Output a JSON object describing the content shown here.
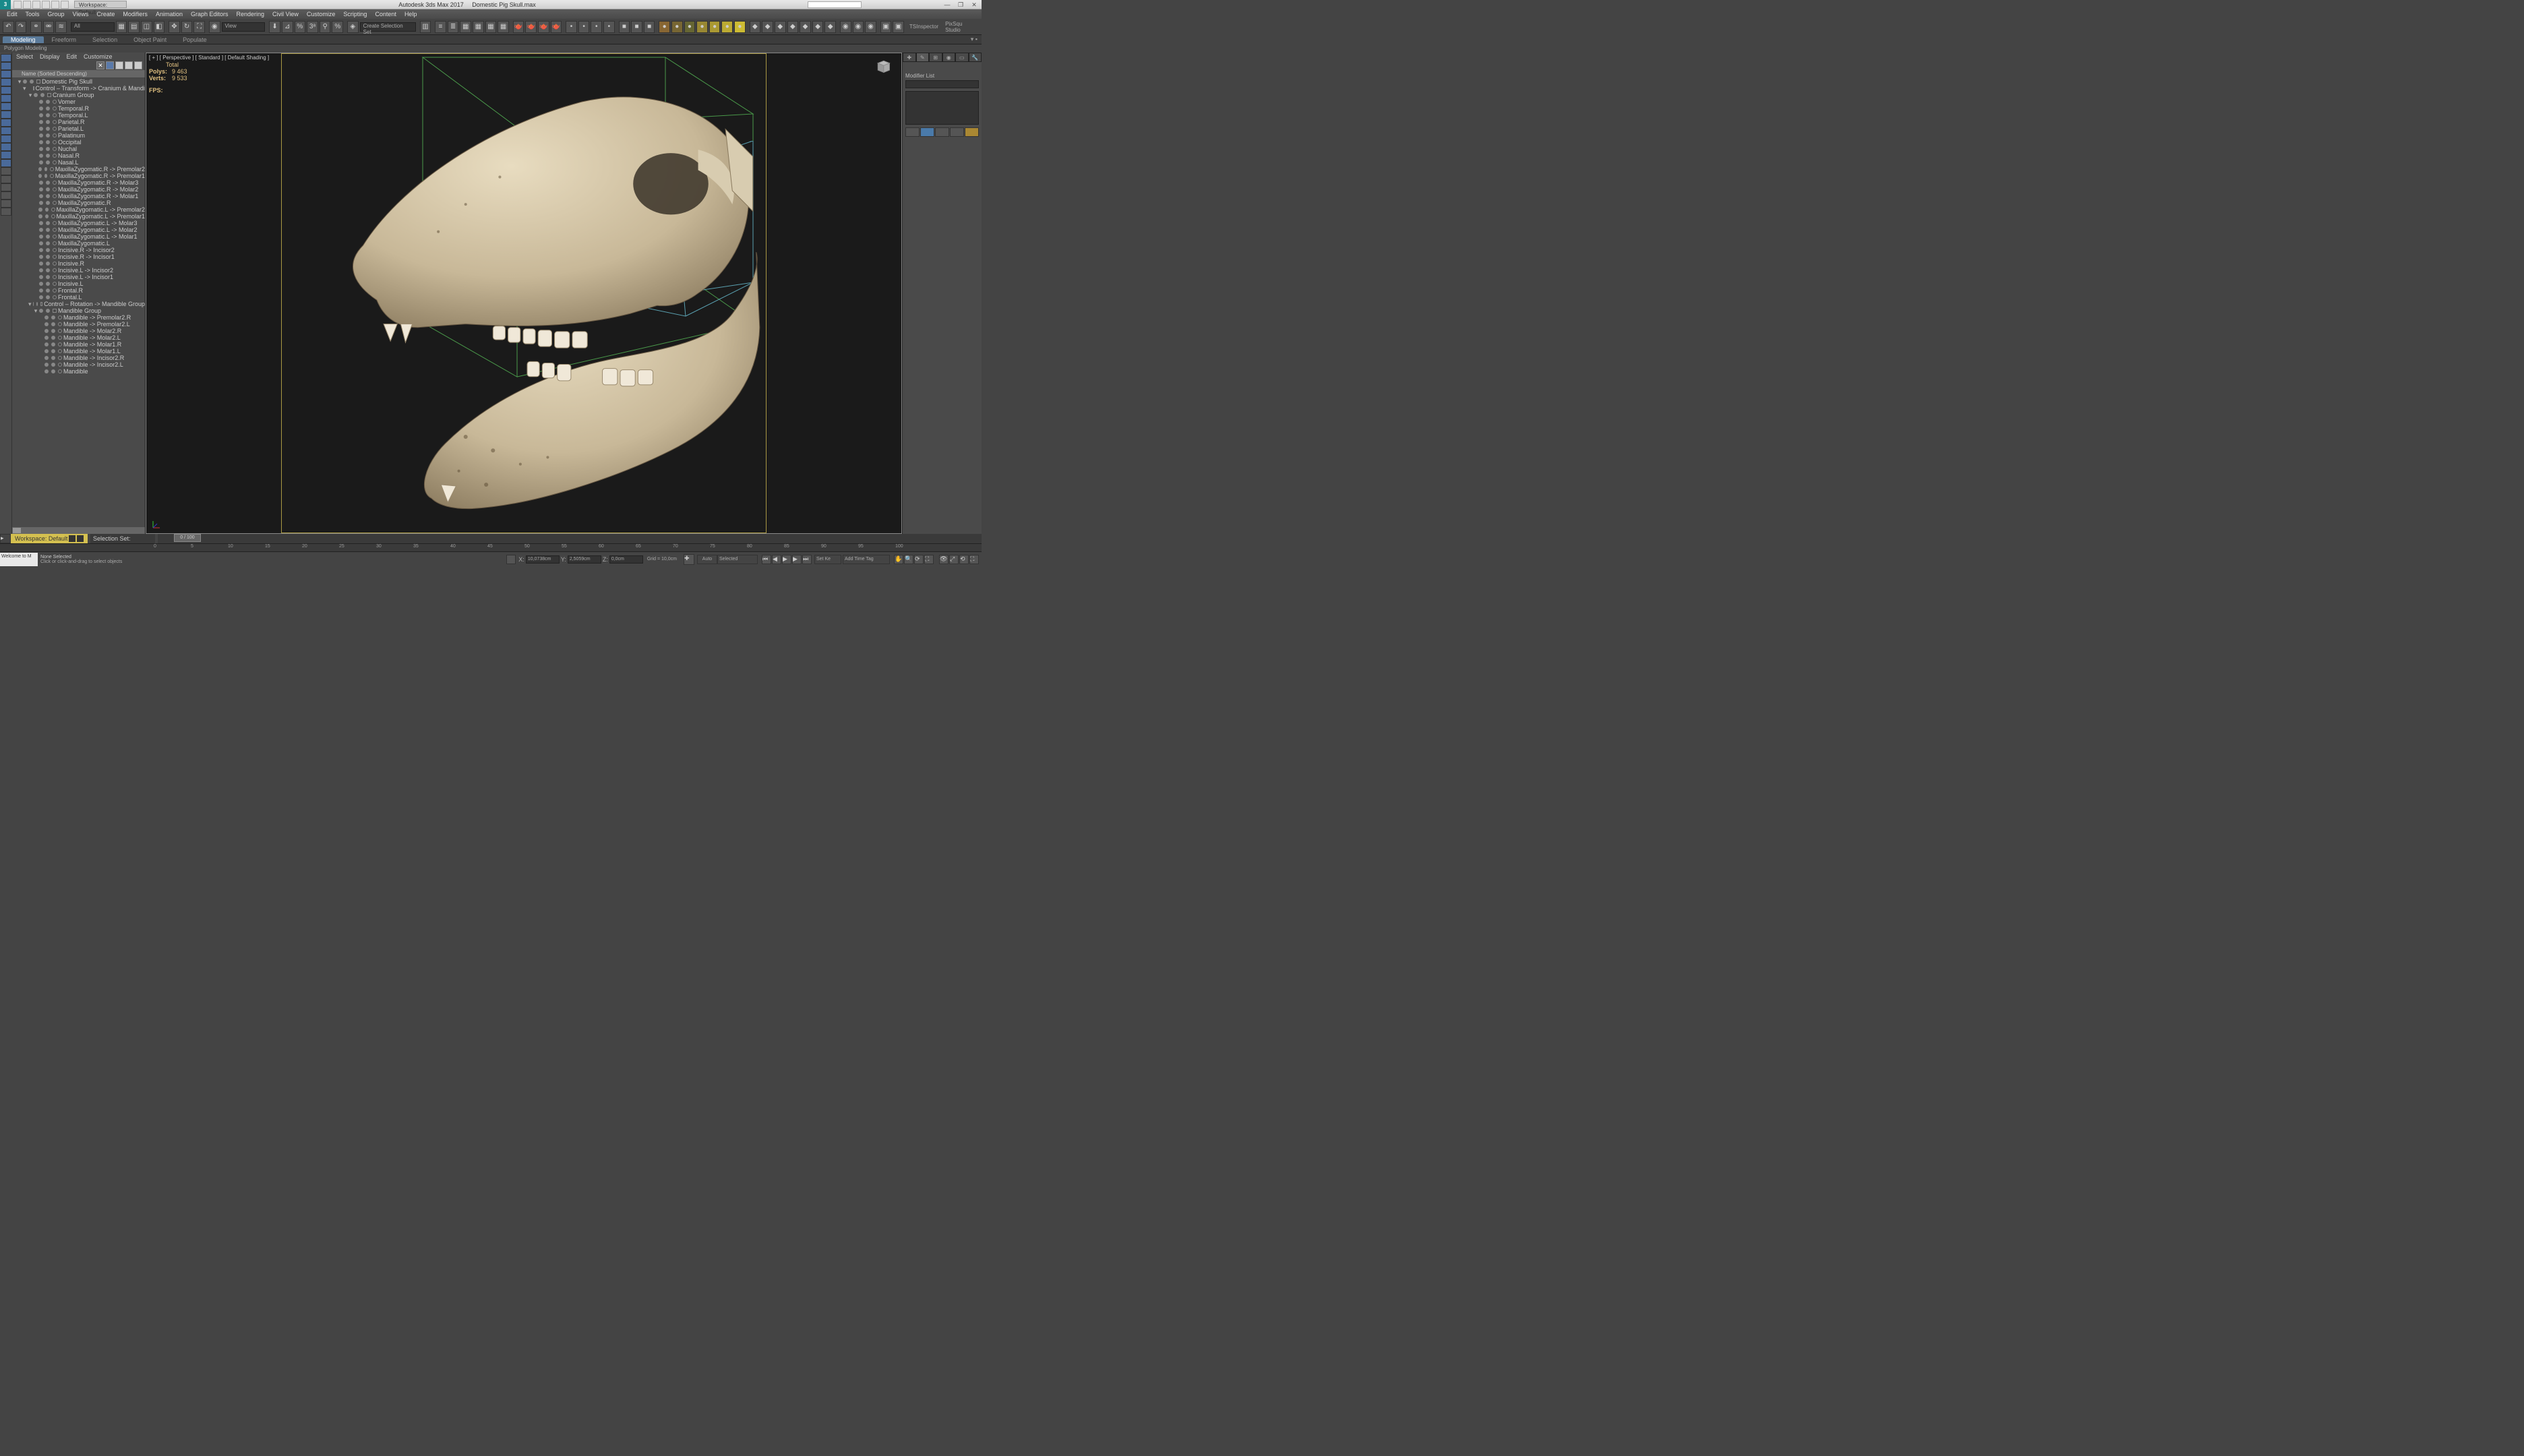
{
  "app": {
    "title": "Autodesk 3ds Max 2017",
    "file": "Domestic Pig Skull.max",
    "workspace": "Workspace: Default",
    "right_labels": [
      "TSInspector",
      "PixSqu Studio"
    ]
  },
  "menu": [
    "Edit",
    "Tools",
    "Group",
    "Views",
    "Create",
    "Modifiers",
    "Animation",
    "Graph Editors",
    "Rendering",
    "Civil View",
    "Customize",
    "Scripting",
    "Content",
    "Help"
  ],
  "maintb": {
    "all": "All",
    "view": "View",
    "create_sel": "Create Selection Set"
  },
  "ribbon": {
    "tabs": [
      "Modeling",
      "Freeform",
      "Selection",
      "Object Paint",
      "Populate"
    ],
    "active": 0
  },
  "polybar": "Polygon Modeling",
  "explorer": {
    "menu": [
      "Select",
      "Display",
      "Edit",
      "Customize"
    ],
    "header": "Name (Sorted Descending)",
    "tree": [
      {
        "d": 0,
        "t": "tw",
        "l": "Domestic Pig Skull"
      },
      {
        "d": 1,
        "t": "tw",
        "l": "Control – Transform -> Cranium & Mandible Group"
      },
      {
        "d": 2,
        "t": "tw",
        "l": "Cranium Group"
      },
      {
        "d": 3,
        "t": "o",
        "l": "Vomer"
      },
      {
        "d": 3,
        "t": "o",
        "l": "Temporal.R"
      },
      {
        "d": 3,
        "t": "o",
        "l": "Temporal.L"
      },
      {
        "d": 3,
        "t": "o",
        "l": "Parietal.R"
      },
      {
        "d": 3,
        "t": "o",
        "l": "Parietal.L"
      },
      {
        "d": 3,
        "t": "o",
        "l": "Palatinum"
      },
      {
        "d": 3,
        "t": "o",
        "l": "Occipital"
      },
      {
        "d": 3,
        "t": "o",
        "l": "Nuchal"
      },
      {
        "d": 3,
        "t": "o",
        "l": "Nasal.R"
      },
      {
        "d": 3,
        "t": "o",
        "l": "Nasal.L"
      },
      {
        "d": 3,
        "t": "o",
        "l": "MaxillaZygomatic.R -> Premolar2"
      },
      {
        "d": 3,
        "t": "o",
        "l": "MaxillaZygomatic.R -> Premolar1"
      },
      {
        "d": 3,
        "t": "o",
        "l": "MaxillaZygomatic.R -> Molar3"
      },
      {
        "d": 3,
        "t": "o",
        "l": "MaxillaZygomatic.R -> Molar2"
      },
      {
        "d": 3,
        "t": "o",
        "l": "MaxillaZygomatic.R -> Molar1"
      },
      {
        "d": 3,
        "t": "o",
        "l": "MaxillaZygomatic.R"
      },
      {
        "d": 3,
        "t": "o",
        "l": "MaxillaZygomatic.L -> Premolar2"
      },
      {
        "d": 3,
        "t": "o",
        "l": "MaxillaZygomatic.L -> Premolar1"
      },
      {
        "d": 3,
        "t": "o",
        "l": "MaxillaZygomatic.L -> Molar3"
      },
      {
        "d": 3,
        "t": "o",
        "l": "MaxillaZygomatic.L -> Molar2"
      },
      {
        "d": 3,
        "t": "o",
        "l": "MaxillaZygomatic.L -> Molar1"
      },
      {
        "d": 3,
        "t": "o",
        "l": "MaxillaZygomatic.L"
      },
      {
        "d": 3,
        "t": "o",
        "l": "Incisive.R -> Incisor2"
      },
      {
        "d": 3,
        "t": "o",
        "l": "Incisive.R -> Incisor1"
      },
      {
        "d": 3,
        "t": "o",
        "l": "Incisive.R"
      },
      {
        "d": 3,
        "t": "o",
        "l": "Incisive.L -> Incisor2"
      },
      {
        "d": 3,
        "t": "o",
        "l": "Incisive.L -> Incisor1"
      },
      {
        "d": 3,
        "t": "o",
        "l": "Incisive.L"
      },
      {
        "d": 3,
        "t": "o",
        "l": "Frontal.R"
      },
      {
        "d": 3,
        "t": "o",
        "l": "Frontal.L"
      },
      {
        "d": 2,
        "t": "tw",
        "l": "Control – Rotation -> Mandible Group"
      },
      {
        "d": 3,
        "t": "tw",
        "l": "Mandible Group"
      },
      {
        "d": 4,
        "t": "o",
        "l": "Mandible -> Premolar2.R"
      },
      {
        "d": 4,
        "t": "o",
        "l": "Mandible -> Premolar2.L"
      },
      {
        "d": 4,
        "t": "o",
        "l": "Mandible -> Molar2.R"
      },
      {
        "d": 4,
        "t": "o",
        "l": "Mandible -> Molar2.L"
      },
      {
        "d": 4,
        "t": "o",
        "l": "Mandible -> Molar1.R"
      },
      {
        "d": 4,
        "t": "o",
        "l": "Mandible -> Molar1.L"
      },
      {
        "d": 4,
        "t": "o",
        "l": "Mandible -> Incisor2.R"
      },
      {
        "d": 4,
        "t": "o",
        "l": "Mandible -> Incisor2.L"
      },
      {
        "d": 4,
        "t": "o",
        "l": "Mandible"
      }
    ]
  },
  "viewport": {
    "label": "[ + ] [ Perspective ] [ Standard ] [ Default Shading ]",
    "stats": {
      "total": "Total",
      "polys_l": "Polys:",
      "polys": "9 463",
      "verts_l": "Verts:",
      "verts": "9 533",
      "fps_l": "FPS:"
    }
  },
  "cmdpanel": {
    "modlist": "Modifier List"
  },
  "bottom": {
    "workspace": "Workspace: Default",
    "selset": "Selection Set:",
    "slider": "0 / 100",
    "ticks": [
      "0",
      "5",
      "10",
      "15",
      "20",
      "25",
      "30",
      "35",
      "40",
      "45",
      "50",
      "55",
      "60",
      "65",
      "70",
      "75",
      "80",
      "85",
      "90",
      "95",
      "100"
    ],
    "none": "None Selected",
    "prompt": "Click or click-and-drag to select objects",
    "welcome": "Welcome to M",
    "x": "X:",
    "y": "Y:",
    "z": "Z:",
    "xv": "10,0738cm",
    "yv": "2,5059cm",
    "zv": "0,0cm",
    "grid": "Grid = 10,0cm",
    "addtag": "Add Time Tag",
    "auto": "Auto",
    "setkey": "Set Ke",
    "selected": "Selected"
  }
}
